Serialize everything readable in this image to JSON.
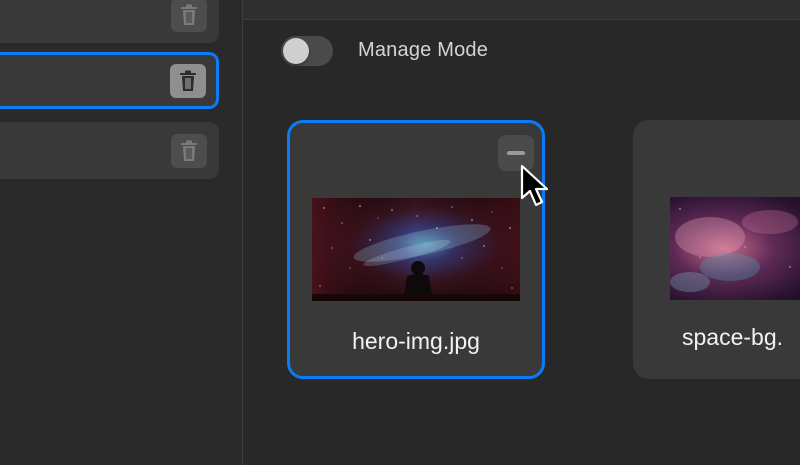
{
  "sidebar": {
    "items": [
      {
        "delete_icon": "trash-icon",
        "selected": false
      },
      {
        "delete_icon": "trash-icon",
        "selected": true
      },
      {
        "delete_icon": "trash-icon",
        "selected": false
      }
    ]
  },
  "toolbar": {
    "manage_mode_label": "Manage Mode",
    "manage_mode_on": false
  },
  "cards": [
    {
      "filename": "hero-img.jpg",
      "selected": true,
      "remove_icon": "minus-icon"
    },
    {
      "filename": "space-bg.",
      "selected": false
    }
  ],
  "colors": {
    "accent": "#0a7cf5",
    "background": "#282828",
    "card": "#393939"
  }
}
